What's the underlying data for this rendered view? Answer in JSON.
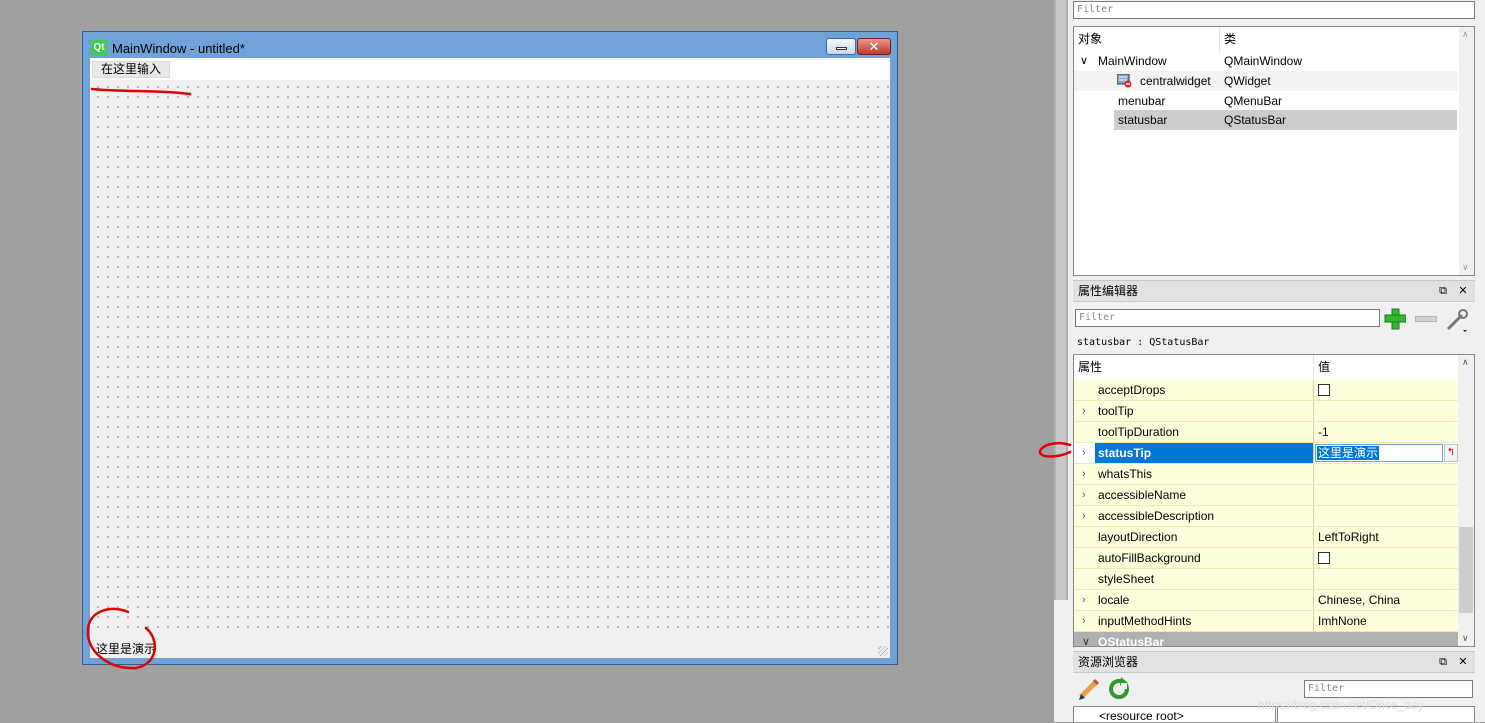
{
  "designer_form": {
    "title": "MainWindow - untitled*",
    "logo_text": "Qt",
    "menubar_placeholder": "在这里输入",
    "status_text": "这里是演示"
  },
  "object_inspector": {
    "filter_placeholder": "Filter",
    "col_object": "对象",
    "col_class": "类",
    "rows": [
      {
        "name": "MainWindow",
        "cls": "QMainWindow"
      },
      {
        "name": "centralwidget",
        "cls": "QWidget"
      },
      {
        "name": "menubar",
        "cls": "QMenuBar"
      },
      {
        "name": "statusbar",
        "cls": "QStatusBar"
      }
    ]
  },
  "property_editor": {
    "title": "属性编辑器",
    "filter_placeholder": "Filter",
    "object_label": "statusbar : QStatusBar",
    "col_property": "属性",
    "col_value": "值",
    "rows": [
      {
        "name": "acceptDrops",
        "value": ""
      },
      {
        "name": "toolTip",
        "value": ""
      },
      {
        "name": "toolTipDuration",
        "value": "-1"
      },
      {
        "name": "statusTip",
        "value": "这里是演示"
      },
      {
        "name": "whatsThis",
        "value": ""
      },
      {
        "name": "accessibleName",
        "value": ""
      },
      {
        "name": "accessibleDescription",
        "value": ""
      },
      {
        "name": "layoutDirection",
        "value": "LeftToRight"
      },
      {
        "name": "autoFillBackground",
        "value": ""
      },
      {
        "name": "styleSheet",
        "value": ""
      },
      {
        "name": "locale",
        "value": "Chinese, China"
      },
      {
        "name": "inputMethodHints",
        "value": "ImhNone"
      },
      {
        "name": "QStatusBar",
        "value": ""
      }
    ]
  },
  "resource_browser": {
    "title": "资源浏览器",
    "filter_placeholder": "Filter",
    "root_label": "<resource root>"
  },
  "watermark": "https://blog.csdn.net/Once_day",
  "icons": {
    "float": "float-icon",
    "close": "close-icon",
    "add": "plus-icon",
    "remove": "minus-icon",
    "configure": "wrench-icon",
    "edit": "pencil-icon",
    "reload": "reload-icon"
  },
  "colors": {
    "selection": "#0078d7",
    "property_row": "#fffedc",
    "group_header": "#b0b0b0",
    "annotation": "#e00000"
  }
}
